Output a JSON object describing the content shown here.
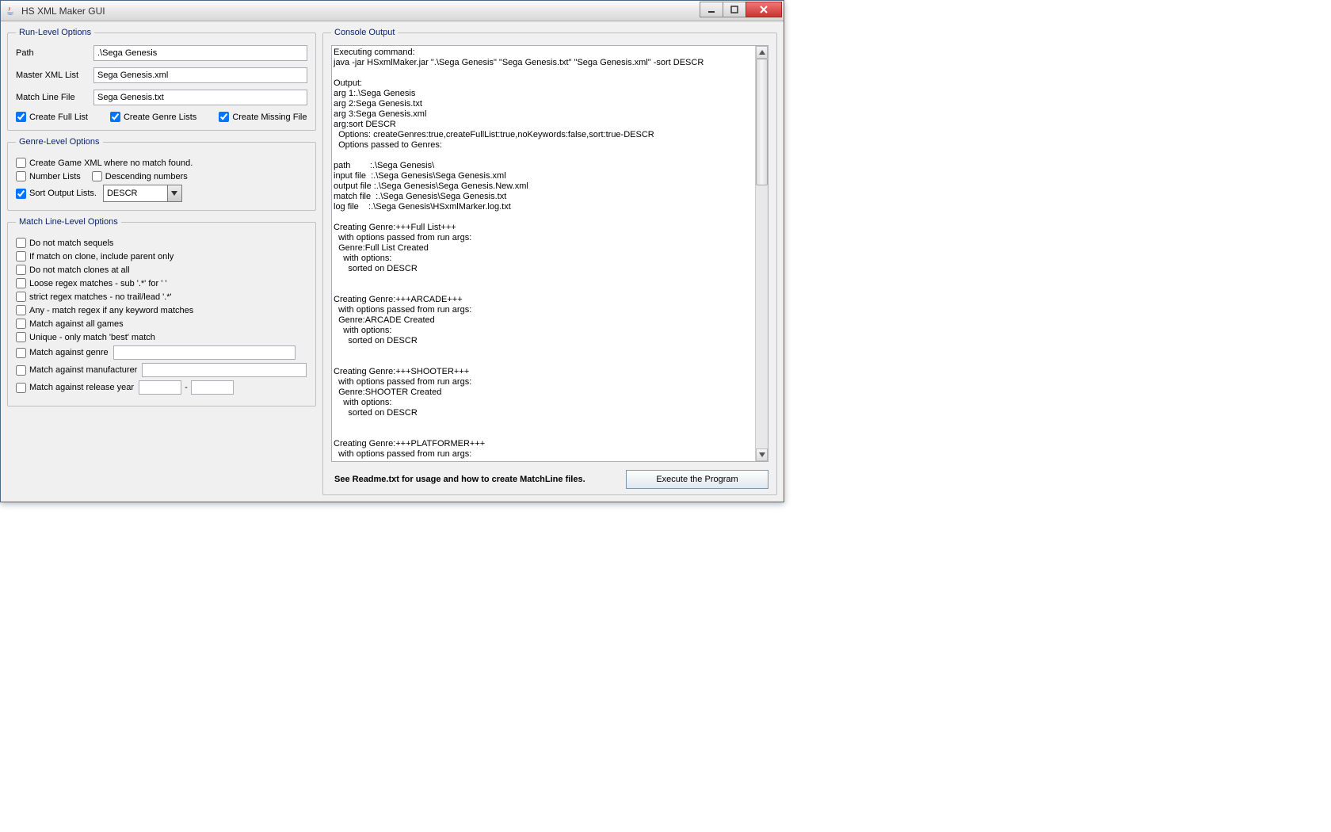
{
  "window": {
    "title": "HS XML Maker GUI"
  },
  "runLevel": {
    "legend": "Run-Level Options",
    "path_label": "Path",
    "path_value": ".\\Sega Genesis",
    "master_label": "Master XML List",
    "master_value": "Sega Genesis.xml",
    "matchline_label": "Match Line File",
    "matchline_value": "Sega Genesis.txt",
    "create_full": "Create Full List",
    "create_genre": "Create Genre Lists",
    "create_missing": "Create Missing File"
  },
  "genreLevel": {
    "legend": "Genre-Level Options",
    "create_game_xml": "Create Game XML where no match found.",
    "number_lists": "Number Lists",
    "descending": "Descending numbers",
    "sort_output": "Sort Output Lists.",
    "sort_value": "DESCR"
  },
  "matchLevel": {
    "legend": "Match Line-Level Options",
    "no_sequels": "Do not match sequels",
    "clone_parent": "If match on clone, include parent only",
    "no_clones": "Do not match clones at all",
    "loose_regex": "Loose regex matches - sub '.*' for ' '",
    "strict_regex": "strict regex matches - no trail/lead '.*'",
    "any_match": "Any - match regex if any keyword matches",
    "match_all": "Match against all games",
    "unique_best": "Unique - only match 'best' match",
    "match_genre": "Match against genre",
    "match_manufacturer": "Match against manufacturer",
    "match_year": "Match against release year",
    "year_sep": "-"
  },
  "console": {
    "legend": "Console Output",
    "text": "Executing command:\njava -jar HSxmlMaker.jar \".\\Sega Genesis\" \"Sega Genesis.txt\" \"Sega Genesis.xml\" -sort DESCR\n\nOutput:\narg 1:.\\Sega Genesis\narg 2:Sega Genesis.txt\narg 3:Sega Genesis.xml\narg:sort DESCR\n  Options: createGenres:true,createFullList:true,noKeywords:false,sort:true-DESCR\n  Options passed to Genres:\n\npath        :.\\Sega Genesis\\\ninput file  :.\\Sega Genesis\\Sega Genesis.xml\noutput file :.\\Sega Genesis\\Sega Genesis.New.xml\nmatch file  :.\\Sega Genesis\\Sega Genesis.txt\nlog file    :.\\Sega Genesis\\HSxmlMarker.log.txt\n\nCreating Genre:+++Full List+++\n  with options passed from run args:\n  Genre:Full List Created\n    with options:\n      sorted on DESCR\n\n\nCreating Genre:+++ARCADE+++\n  with options passed from run args:\n  Genre:ARCADE Created\n    with options:\n      sorted on DESCR\n\n\nCreating Genre:+++SHOOTER+++\n  with options passed from run args:\n  Genre:SHOOTER Created\n    with options:\n      sorted on DESCR\n\n\nCreating Genre:+++PLATFORMER+++\n  with options passed from run args:",
    "readme": "See Readme.txt for usage and how to create MatchLine files.",
    "execute": "Execute the Program"
  }
}
